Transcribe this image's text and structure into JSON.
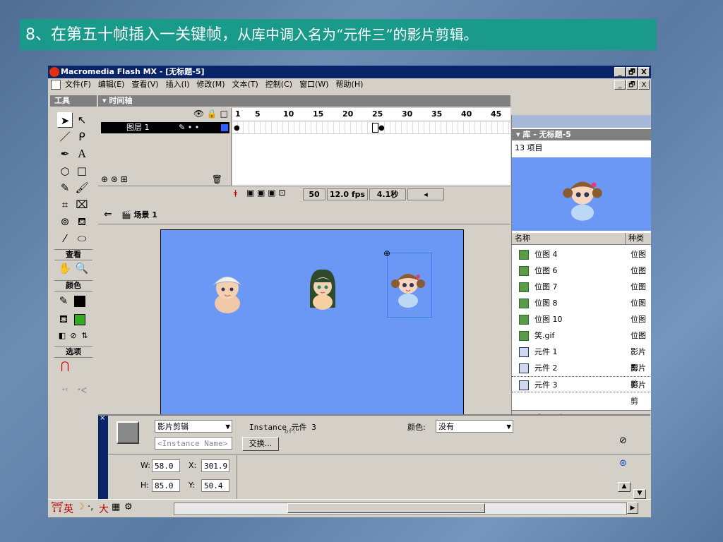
{
  "caption": {
    "part1": "8、在第五十帧插入一关键帧，",
    "part2": "从库中调入名为“元件三”的影片剪辑。"
  },
  "window": {
    "title": "Macromedia Flash MX - [无标题-5]",
    "btn_min": "_",
    "btn_max": "🗗",
    "btn_close": "X"
  },
  "menu": [
    "文件(F)",
    "编辑(E)",
    "查看(V)",
    "插入(I)",
    "修改(M)",
    "文本(T)",
    "控制(C)",
    "窗口(W)",
    "帮助(H)"
  ],
  "tools": {
    "title": "工具",
    "view_label": "查看",
    "colors_label": "颜色",
    "options_label": "选项",
    "colors": {
      "stroke": "#000000",
      "fill": "#33aa22"
    }
  },
  "timeline": {
    "title": "时间轴",
    "layer_name": "图层 1",
    "ruler": [
      "1",
      "5",
      "10",
      "15",
      "20",
      "25",
      "30",
      "35",
      "40",
      "45"
    ],
    "current_frame": "50",
    "fps": "12.0 fps",
    "time": "4.1秒"
  },
  "scene": {
    "name": "场景 1"
  },
  "library": {
    "title": "库 - 无标题-5",
    "count": "13 项目",
    "col_name": "名称",
    "col_kind": "种类",
    "items": [
      {
        "name": "位图 4",
        "kind": "位图",
        "type": "bitmap"
      },
      {
        "name": "位图 6",
        "kind": "位图",
        "type": "bitmap"
      },
      {
        "name": "位图 7",
        "kind": "位图",
        "type": "bitmap"
      },
      {
        "name": "位图 8",
        "kind": "位图",
        "type": "bitmap"
      },
      {
        "name": "位图 10",
        "kind": "位图",
        "type": "bitmap"
      },
      {
        "name": "笑.gif",
        "kind": "位图",
        "type": "bitmap"
      },
      {
        "name": "元件 1",
        "kind": "影片剪",
        "type": "movieclip"
      },
      {
        "name": "元件 2",
        "kind": "影片剪",
        "type": "movieclip"
      },
      {
        "name": "元件 3",
        "kind": "影片剪",
        "type": "movieclip",
        "selected": true
      }
    ]
  },
  "properties": {
    "type_value": "影片剪辑",
    "instance_placeholder": "<Instance Name>",
    "instance_of": "Instance 元件 3",
    "of_label": "of:",
    "swap_label": "交换...",
    "color_label": "颜色:",
    "color_value": "没有",
    "w_label": "W:",
    "w": "58.0",
    "h_label": "H:",
    "h": "85.0",
    "x_label": "X:",
    "x": "301.9",
    "y_label": "Y:",
    "y": "50.4"
  },
  "taskbar": {
    "ime": "英",
    "ime_extra": "大"
  }
}
